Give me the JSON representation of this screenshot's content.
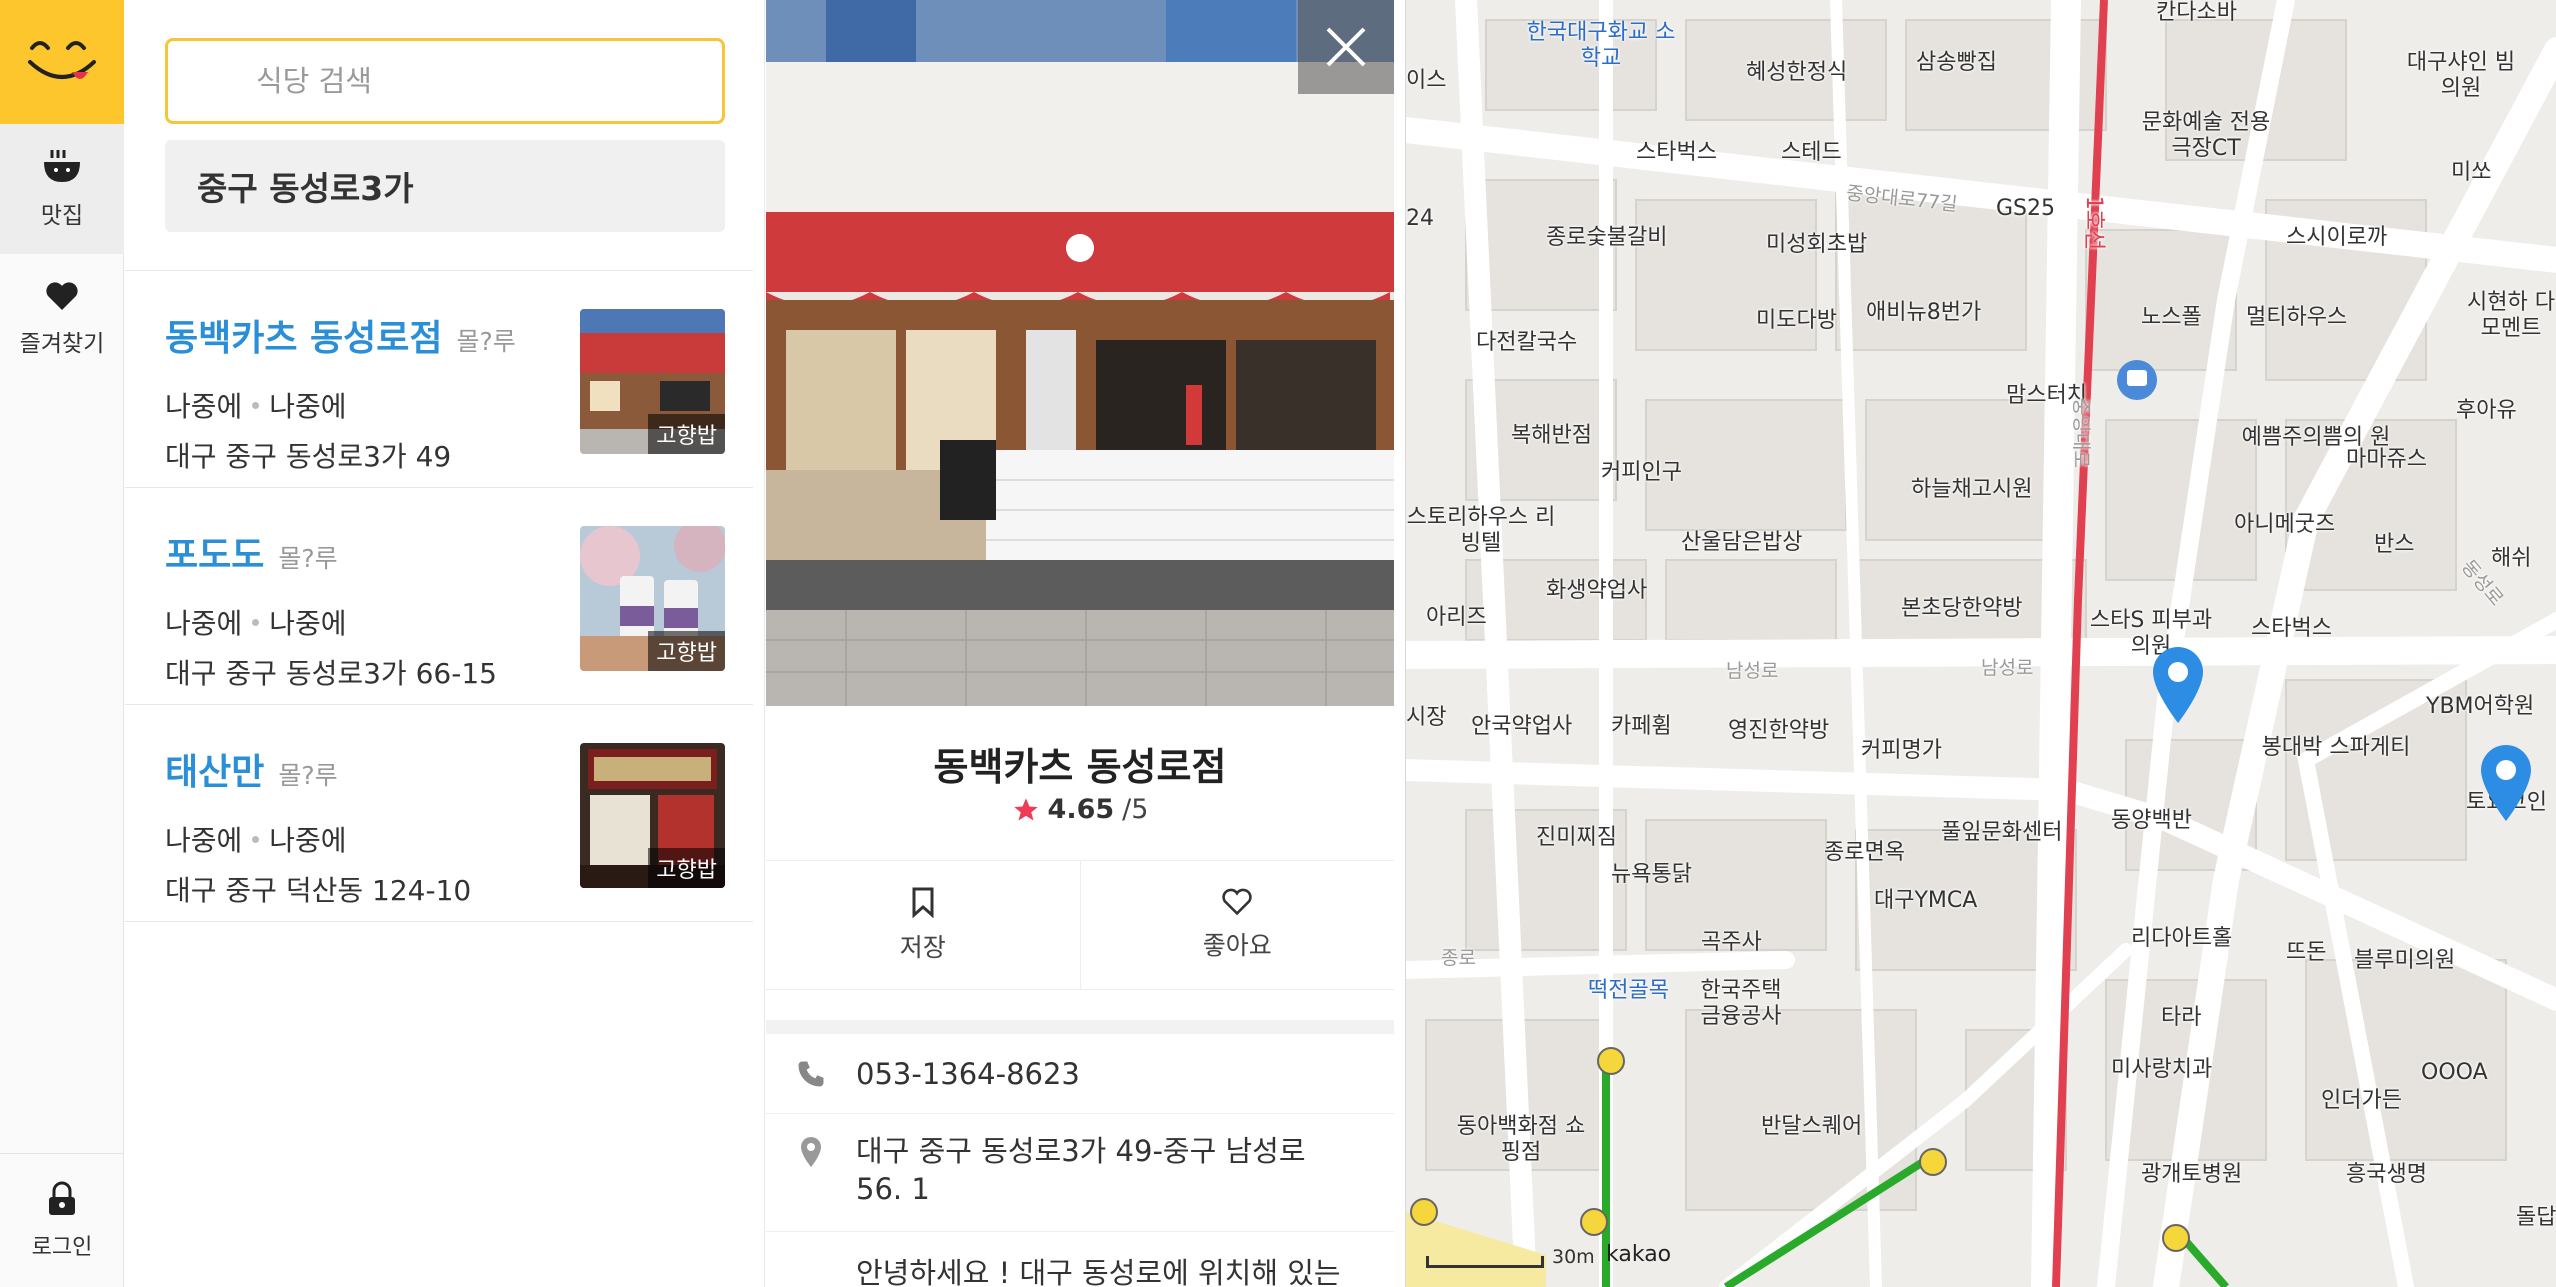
{
  "rail": {
    "items": [
      {
        "label": "맛집"
      },
      {
        "label": "즐겨찾기"
      }
    ],
    "login_label": "로그인"
  },
  "search": {
    "placeholder": "식당 검색",
    "value": ""
  },
  "region_label": "중구 동성로3가",
  "restaurants": [
    {
      "name": "동백카츠 동성로점",
      "tag": "몰?루",
      "hours_a": "나중에",
      "hours_b": "나중에",
      "address": "대구 중구 동성로3가 49",
      "badge": "고향밥"
    },
    {
      "name": "포도도",
      "tag": "몰?루",
      "hours_a": "나중에",
      "hours_b": "나중에",
      "address": "대구 중구 동성로3가 66-15",
      "badge": "고향밥"
    },
    {
      "name": "태산만",
      "tag": "몰?루",
      "hours_a": "나중에",
      "hours_b": "나중에",
      "address": "대구 중구 덕산동 124-10",
      "badge": "고향밥"
    }
  ],
  "detail": {
    "title": "동백카츠 동성로점",
    "score": "4.65",
    "score_max": "/5",
    "save_label": "저장",
    "like_label": "좋아요",
    "phone": "053-1364-8623",
    "address": "대구 중구 동성로3가 49-중구 남성로 56. 1",
    "description": "안녕하세요 ! 대구 동성로에 위치해 있는"
  },
  "map": {
    "labels": [
      "한국대구화교 소학교",
      "혜성한정식",
      "삼송빵집",
      "칸다소바",
      "대구샤인 빔의원",
      "이스",
      "문화예술 전용극장CT",
      "미쏘",
      "스타벅스",
      "스테드",
      "GS25",
      "스시이로까",
      "미성회초밥",
      "종로숯불갈비",
      "미도다방",
      "애비뉴8번가",
      "노스폴",
      "멀티하우스",
      "시현하 다모멘트",
      "다전칼국수",
      "맘스터치",
      "복해반점",
      "예쁨주의쁨의 원",
      "마마쥬스",
      "후아유",
      "커피인구",
      "하늘채고시원",
      "스토리하우스 리빙텔",
      "산울담은밥상",
      "아니메굿즈",
      "반스",
      "해쉬",
      "아리즈",
      "화생약업사",
      "본초당한약방",
      "스타S 피부과의원",
      "스타벅스",
      "시장",
      "안국약업사",
      "카페휨",
      "영진한약방",
      "커피명가",
      "YBM어학원",
      "봉대박 스파게티",
      "동양백반",
      "토요코인",
      "진미찌짐",
      "뉴욕통닭",
      "종로면옥",
      "풀잎문화센터",
      "대구YMCA",
      "리다아트홀",
      "뜨돈",
      "블루미의원",
      "곡주사",
      "떡전골목",
      "한국주택 금융공사",
      "타라",
      "미사랑치과",
      "OOOA",
      "인더가든",
      "동아백화점 쇼핑점",
      "반달스퀘어",
      "광개토병원",
      "흥국생명",
      "돌답",
      "중앙대로77길",
      "남성로",
      "남성로",
      "종로",
      "동성로",
      "24",
      "중앙대로",
      "1호선"
    ],
    "scale_label": "30m",
    "brand": "kakao"
  },
  "colors": {
    "accent": "#fdc62c",
    "link": "#2a8fd6",
    "pin": "#2d8ce4",
    "subway_red": "#e04050",
    "bus_green": "#2aaa2a"
  }
}
